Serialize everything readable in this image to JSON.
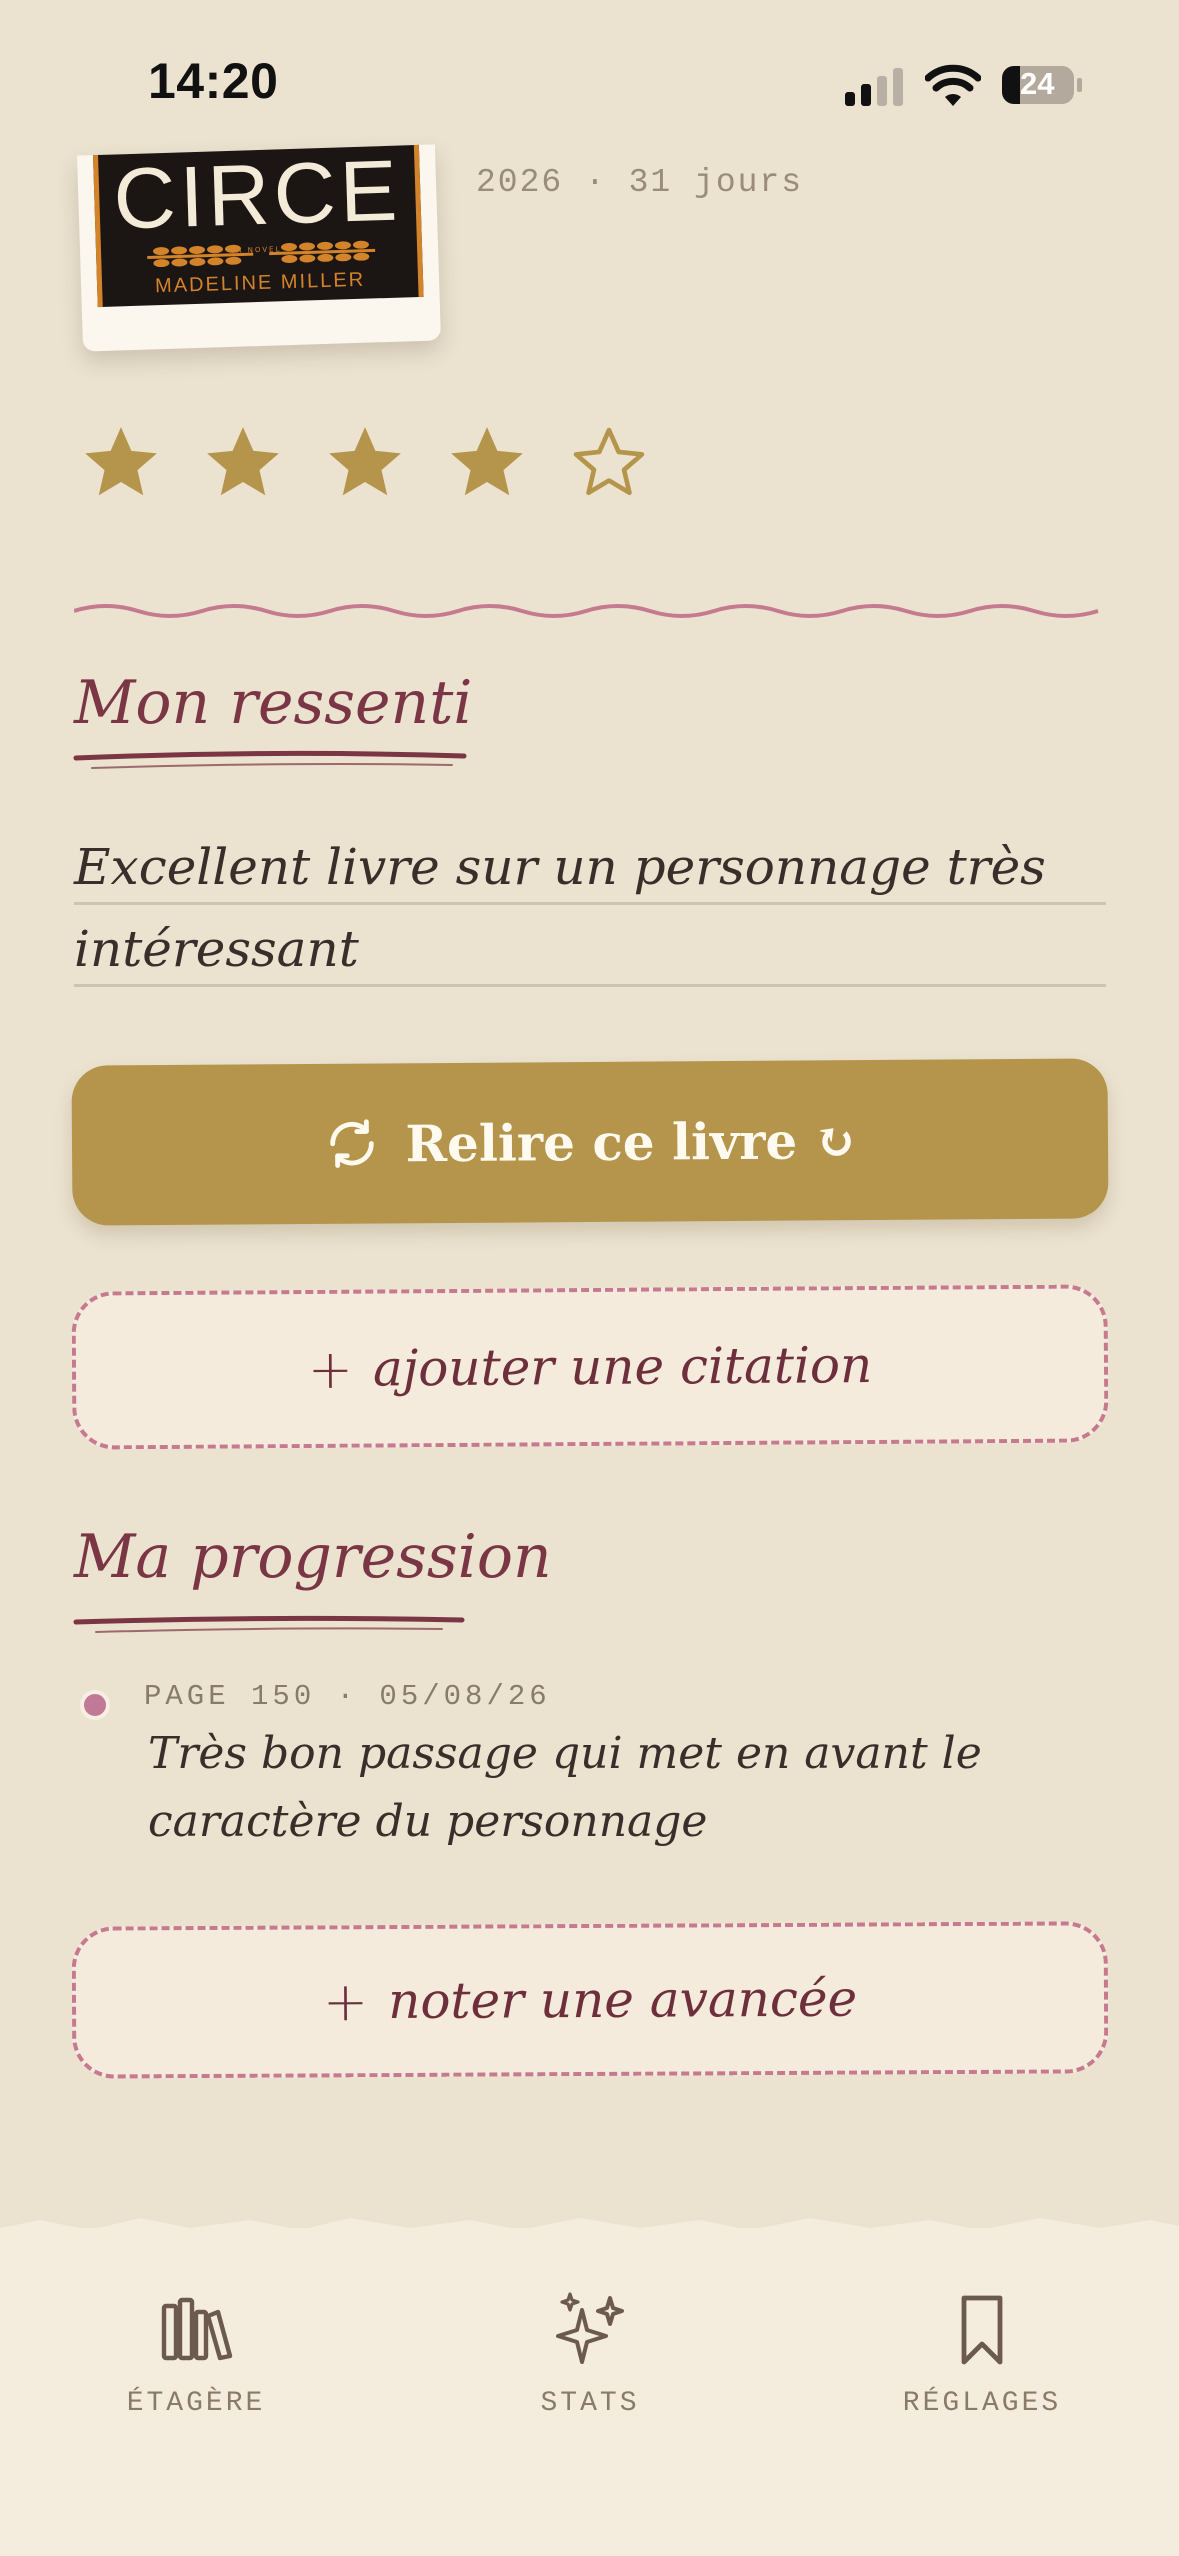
{
  "status_bar": {
    "time": "14:20",
    "battery": "24"
  },
  "book": {
    "cover_title": "CIRCE",
    "cover_subtitle": "A NOVEL",
    "cover_author": "MADELINE MILLER",
    "date_line": "2026 · 31 jours"
  },
  "rating": {
    "value": 4,
    "max": 5
  },
  "ressenti": {
    "title": "Mon ressenti",
    "line1": "Excellent livre sur un personnage très",
    "line2": "intéressant"
  },
  "reread_button": {
    "label": "Relire ce livre ↻"
  },
  "citation_button": {
    "plus": "+",
    "label": "ajouter une citation"
  },
  "progression": {
    "title": "Ma progression",
    "entries": [
      {
        "meta": "PAGE 150 · 05/08/26",
        "text": "Très bon passage qui met en avant le caractère du personnage"
      }
    ]
  },
  "progress_button": {
    "plus": "+",
    "label": "noter une avancée"
  },
  "nav": {
    "tabs": [
      {
        "label": "ÉTAGÈRE",
        "icon": "bookshelf-icon"
      },
      {
        "label": "STATS",
        "icon": "sparkles-icon"
      },
      {
        "label": "RÉGLAGES",
        "icon": "bookmark-icon"
      }
    ]
  },
  "colors": {
    "background": "#ebe2d0",
    "gold": "#b4954b",
    "burgundy": "#7a3645",
    "rose": "#c67a8f"
  }
}
